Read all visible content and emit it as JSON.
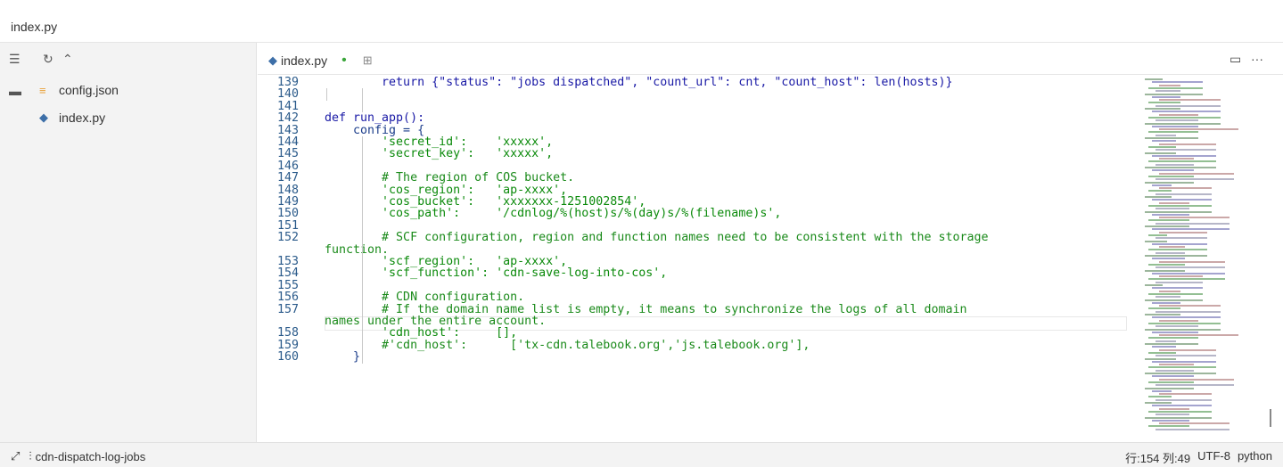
{
  "window": {
    "title": "index.py"
  },
  "sidebar": {
    "files": [
      {
        "name": "config.json",
        "icon": "json-file-icon"
      },
      {
        "name": "index.py",
        "icon": "python-file-icon"
      }
    ]
  },
  "tabs": [
    {
      "label": "index.py",
      "modified": true
    }
  ],
  "editor": {
    "lines": [
      {
        "num": "139",
        "text": "        return {\"status\": \"jobs dispatched\", \"count_url\": cnt, \"count_host\": len(hosts)}"
      },
      {
        "num": "140",
        "text": ""
      },
      {
        "num": "141",
        "text": ""
      },
      {
        "num": "142",
        "text": "def run_app():"
      },
      {
        "num": "143",
        "text": "    config = {"
      },
      {
        "num": "144",
        "text": "        'secret_id':    'xxxxx',"
      },
      {
        "num": "145",
        "text": "        'secret_key':   'xxxxx',"
      },
      {
        "num": "146",
        "text": ""
      },
      {
        "num": "147",
        "text": "        # The region of COS bucket."
      },
      {
        "num": "148",
        "text": "        'cos_region':   'ap-xxxx',"
      },
      {
        "num": "149",
        "text": "        'cos_bucket':   'xxxxxxx-1251002854',"
      },
      {
        "num": "150",
        "text": "        'cos_path':     '/cdnlog/%(host)s/%(day)s/%(filename)s',"
      },
      {
        "num": "151",
        "text": ""
      },
      {
        "num": "152",
        "text": "        # SCF configuration, region and function names need to be consistent with the storage"
      },
      {
        "num": "",
        "text": "function."
      },
      {
        "num": "153",
        "text": "        'scf_region':   'ap-xxxx',"
      },
      {
        "num": "154",
        "text": "        'scf_function': 'cdn-save-log-into-cos',"
      },
      {
        "num": "155",
        "text": ""
      },
      {
        "num": "156",
        "text": "        # CDN configuration."
      },
      {
        "num": "157",
        "text": "        # If the domain name list is empty, it means to synchronize the logs of all domain"
      },
      {
        "num": "",
        "text": "names under the entire account."
      },
      {
        "num": "158",
        "text": "        'cdn_host':     [],"
      },
      {
        "num": "159",
        "text": "        #'cdn_host':      ['tx-cdn.talebook.org','js.talebook.org'],"
      },
      {
        "num": "160",
        "text": "    }"
      }
    ]
  },
  "status": {
    "project": "cdn-dispatch-log-jobs",
    "position": "行:154 列:49",
    "encoding": "UTF-8",
    "language": "python"
  }
}
